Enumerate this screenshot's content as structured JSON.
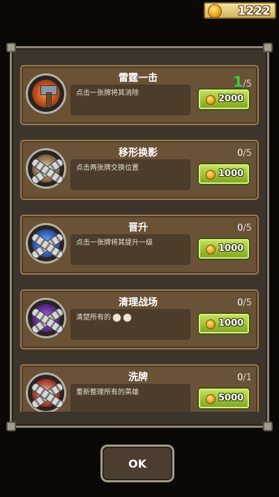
{
  "hud": {
    "coins": "1222"
  },
  "items": [
    {
      "title": "雷霆一击",
      "current": "1",
      "max": "/5",
      "description": "点击一张牌将其消除",
      "price": "2000",
      "icon": "hammer-icon",
      "locked": false,
      "highlight_current": true
    },
    {
      "title": "移形换影",
      "current": "0",
      "max": "/5",
      "description": "点击两张牌交换位置",
      "price": "1000",
      "icon": "swap-scroll-icon",
      "locked": true,
      "highlight_current": false
    },
    {
      "title": "晋升",
      "current": "0",
      "max": "/5",
      "description": "点击一张牌将其提升一级",
      "price": "1000",
      "icon": "promote-icon",
      "locked": true,
      "highlight_current": false
    },
    {
      "title": "清理战场",
      "current": "0",
      "max": "/5",
      "description": "清楚所有的",
      "price": "1000",
      "icon": "clear-field-icon",
      "locked": true,
      "highlight_current": false
    },
    {
      "title": "洗牌",
      "current": "0",
      "max": "/1",
      "description": "重新整理所有的英雄",
      "price": "5000",
      "icon": "shuffle-icon",
      "locked": true,
      "highlight_current": false
    }
  ],
  "ok_button": {
    "label": "OK"
  }
}
